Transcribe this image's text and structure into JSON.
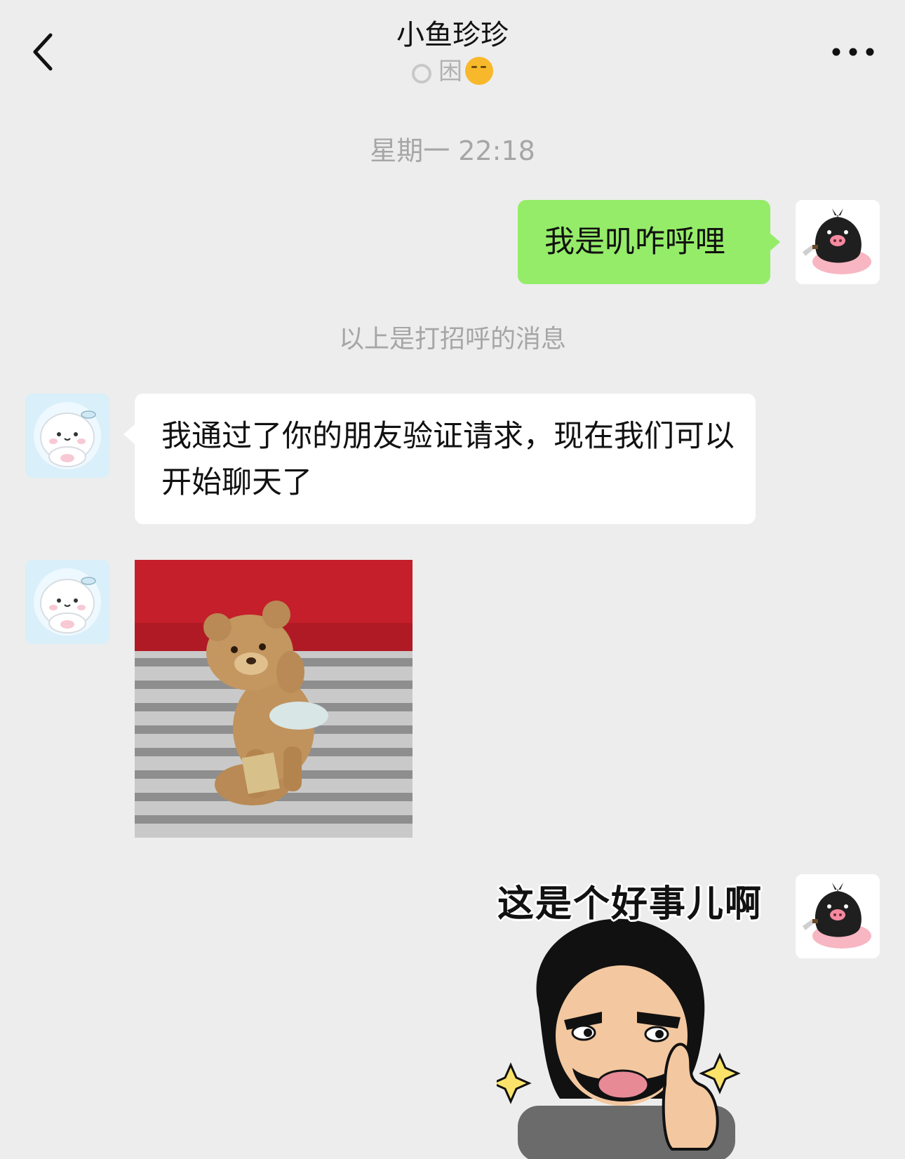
{
  "header": {
    "title": "小鱼珍珍",
    "status_text": "困",
    "status_icon": "loading-ring-icon",
    "status_emoji": "yawning-face-icon",
    "back_icon": "chevron-left-icon",
    "more_icon": "more-dots-icon"
  },
  "messages": {
    "timestamp": "星期一 22:18",
    "greeting": {
      "sender": "me",
      "text": "我是叽咋呼哩"
    },
    "system_note": "以上是打招呼的消息",
    "friend_accept": {
      "sender": "other",
      "text": "我通过了你的朋友验证请求，现在我们可以开始聊天了"
    },
    "teddy_photo": {
      "sender": "other",
      "type": "image"
    },
    "sticker": {
      "sender": "me",
      "type": "sticker",
      "caption": "这是个好事儿啊"
    }
  },
  "colors": {
    "background": "#ededed",
    "my_bubble": "#95ec69",
    "other_bubble": "#ffffff",
    "meta_text": "#a6a6a6"
  }
}
